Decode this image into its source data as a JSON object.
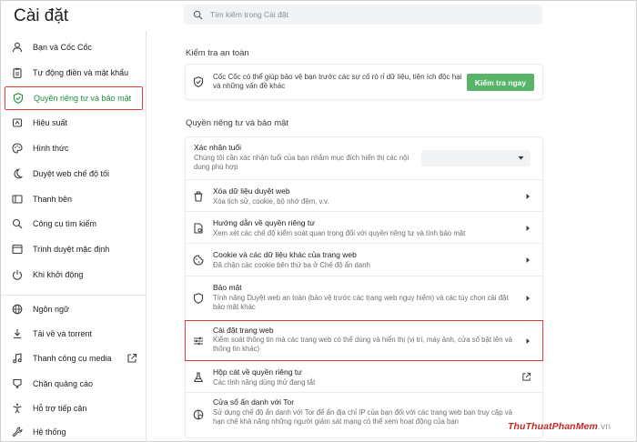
{
  "app": {
    "title": "Cài đặt"
  },
  "search": {
    "placeholder": "Tìm kiếm trong Cài đặt"
  },
  "sidebar": {
    "items": [
      {
        "label": "Bạn và Cốc Cốc",
        "icon": "person-icon"
      },
      {
        "label": "Tự động điền và mật khẩu",
        "icon": "clipboard-icon"
      },
      {
        "label": "Quyền riêng tư và bảo mật",
        "icon": "shield-icon",
        "active": true
      },
      {
        "label": "Hiệu suất",
        "icon": "speed-icon"
      },
      {
        "label": "Hình thức",
        "icon": "palette-icon"
      },
      {
        "label": "Duyệt web chế độ tối",
        "icon": "moon-icon"
      },
      {
        "label": "Thanh bên",
        "icon": "sidebar-panel-icon"
      },
      {
        "label": "Công cụ tìm kiếm",
        "icon": "search-icon"
      },
      {
        "label": "Trình duyệt mặc định",
        "icon": "browser-window-icon"
      },
      {
        "label": "Khi khởi động",
        "icon": "power-icon"
      },
      {
        "label": "Ngôn ngữ",
        "icon": "globe-icon"
      },
      {
        "label": "Tải về và torrent",
        "icon": "download-icon"
      },
      {
        "label": "Thanh công cụ media",
        "icon": "music-icon",
        "external": true
      },
      {
        "label": "Chặn quảng cáo",
        "icon": "block-icon"
      },
      {
        "label": "Hỗ trợ tiếp cận",
        "icon": "accessibility-icon"
      },
      {
        "label": "Hệ thống",
        "icon": "wrench-icon"
      }
    ]
  },
  "safety_check": {
    "section_title": "Kiểm tra an toàn",
    "description": "Cốc Cốc có thể giúp bảo vệ bạn trước các sự cố rò rỉ dữ liệu, tiện ích độc hại và những vấn đề khác",
    "button_label": "Kiểm tra ngay"
  },
  "privacy": {
    "section_title": "Quyền riêng tư và bảo mật",
    "age": {
      "title": "Xác nhận tuổi",
      "description": "Chúng tôi cần xác nhận tuổi của bạn nhằm mục đích hiển thị các nội dung phù hợp",
      "select_value": ""
    },
    "rows": [
      {
        "title": "Xóa dữ liệu duyệt web",
        "description": "Xóa lịch sử, cookie, bộ nhớ đệm, v.v.",
        "icon": "trash-icon"
      },
      {
        "title": "Hướng dẫn về quyền riêng tư",
        "description": "Xem xét các chế độ kiểm soát quan trọng đối với quyền riêng tư và tính bảo mật",
        "icon": "privacy-guide-icon"
      },
      {
        "title": "Cookie và các dữ liệu khác của trang web",
        "description": "Đã chặn các cookie bên thứ ba ở Chế độ ẩn danh",
        "icon": "cookie-icon"
      },
      {
        "title": "Bảo mật",
        "description": "Tính năng Duyệt web an toàn (bảo vệ trước các trang web nguy hiểm) và các tùy chọn cài đặt bảo mật khác",
        "icon": "security-shield-icon"
      },
      {
        "title": "Cài đặt trang web",
        "description": "Kiểm soát thông tin mà các trang web có thể dùng và hiển thị (vị trí, máy ảnh, cửa sổ bật lên và thông tin khác)",
        "icon": "sliders-icon",
        "highlight": true
      },
      {
        "title": "Hộp cát về quyền riêng tư",
        "description": "Các tính năng dùng thử đang tắt",
        "icon": "flask-icon",
        "external": true
      },
      {
        "title": "Cửa sổ ẩn danh với Tor",
        "description": "Sử dụng chế độ ẩn danh với Tor để ẩn địa chỉ IP của bạn đối với các trang web bạn truy cập và hạn chế khả năng những người giám sát mạng có thể xem hoạt động của bạn",
        "icon": "tor-icon"
      }
    ]
  },
  "watermark": {
    "text_main": "ThuThuatPhanMem",
    "text_tail": ".vn"
  },
  "colors": {
    "accent": "#1e8e3e",
    "button": "#57b469",
    "highlight_border": "#e53935"
  }
}
